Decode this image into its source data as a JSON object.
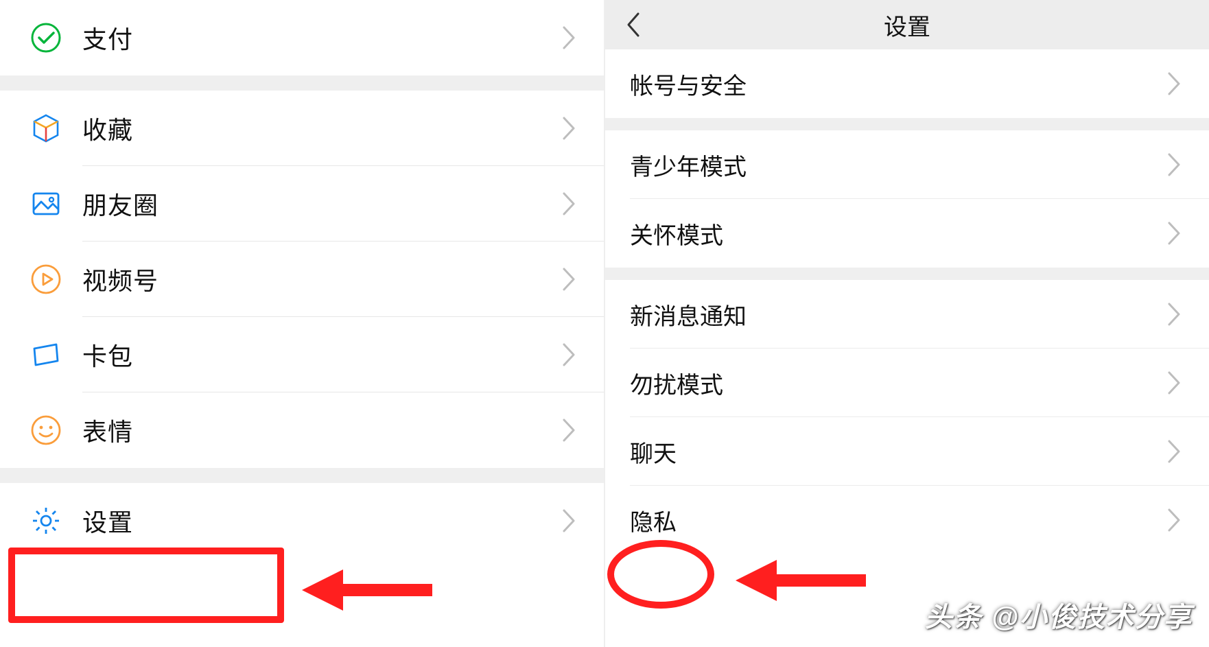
{
  "left": {
    "pay": {
      "label": "支付"
    },
    "fav": {
      "label": "收藏"
    },
    "moments": {
      "label": "朋友圈"
    },
    "channels": {
      "label": "视频号"
    },
    "cards": {
      "label": "卡包"
    },
    "sticker": {
      "label": "表情"
    },
    "settings": {
      "label": "设置"
    }
  },
  "right": {
    "header_title": "设置",
    "account_security": "帐号与安全",
    "teen_mode": "青少年模式",
    "care_mode": "关怀模式",
    "new_msg_notify": "新消息通知",
    "dnd": "勿扰模式",
    "chat": "聊天",
    "privacy": "隐私"
  },
  "watermark": "头条 @小俊技术分享"
}
